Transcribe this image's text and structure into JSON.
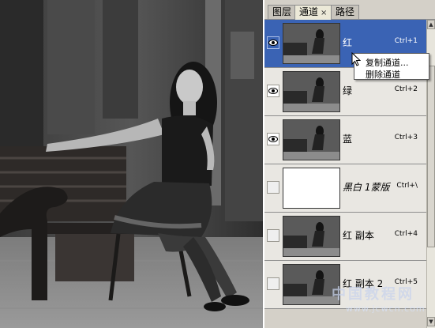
{
  "tabs": [
    {
      "label": "图层",
      "active": false
    },
    {
      "label": "通道",
      "active": true
    },
    {
      "label": "路径",
      "active": false
    }
  ],
  "tab_close_glyph": "×",
  "channels": [
    {
      "name": "红",
      "shortcut": "Ctrl+1",
      "visible": true,
      "selected": true,
      "thumbnail": "photo"
    },
    {
      "name": "绿",
      "shortcut": "Ctrl+2",
      "visible": true,
      "selected": false,
      "thumbnail": "photo"
    },
    {
      "name": "蓝",
      "shortcut": "Ctrl+3",
      "visible": true,
      "selected": false,
      "thumbnail": "photo"
    },
    {
      "name": "黑白 1蒙版",
      "shortcut": "Ctrl+\\",
      "visible": false,
      "selected": false,
      "thumbnail": "white"
    },
    {
      "name": "红 副本",
      "shortcut": "Ctrl+4",
      "visible": false,
      "selected": false,
      "thumbnail": "photo"
    },
    {
      "name": "红 副本 2",
      "shortcut": "Ctrl+5",
      "visible": false,
      "selected": false,
      "thumbnail": "photo"
    }
  ],
  "context_menu": {
    "items": [
      "复制通道...",
      "删除通道"
    ]
  },
  "watermark": {
    "title": "中国教程网",
    "url": "www.jcwcn.com"
  },
  "colors": {
    "panel_bg": "#d4d0c8",
    "selection": "#3a63b4"
  },
  "icons": {
    "visibility": "eye-icon",
    "cursor": "arrow-cursor-icon"
  }
}
